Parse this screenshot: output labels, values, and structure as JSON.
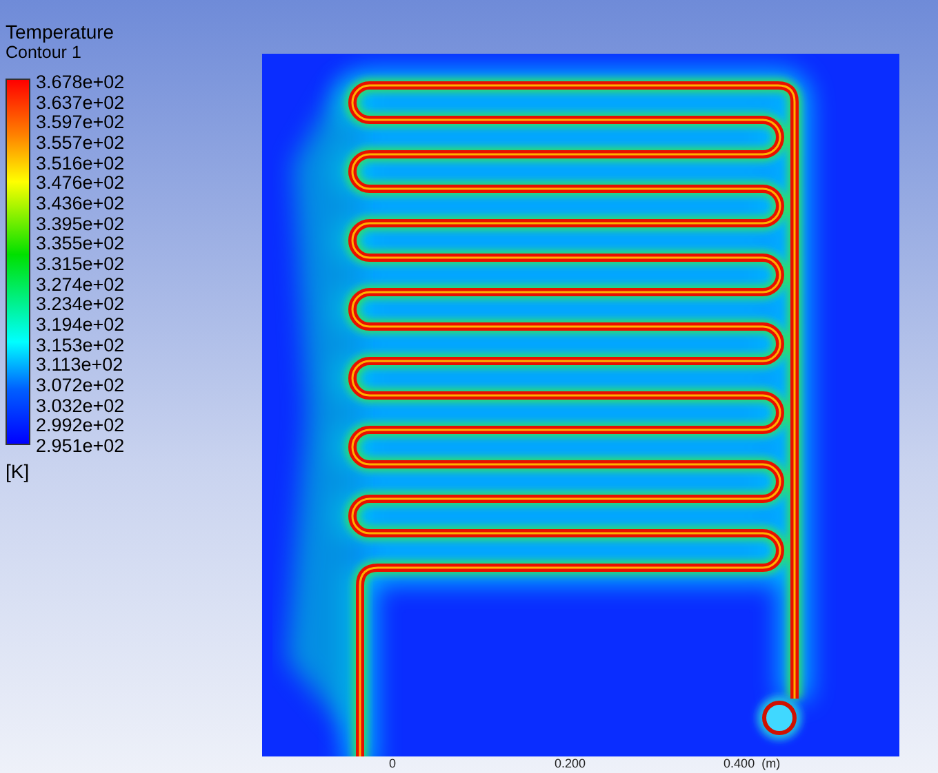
{
  "legend": {
    "title": "Temperature",
    "subtitle": "Contour 1",
    "labels": [
      "3.678e+02",
      "3.637e+02",
      "3.597e+02",
      "3.557e+02",
      "3.516e+02",
      "3.476e+02",
      "3.436e+02",
      "3.395e+02",
      "3.355e+02",
      "3.315e+02",
      "3.274e+02",
      "3.234e+02",
      "3.194e+02",
      "3.153e+02",
      "3.113e+02",
      "3.072e+02",
      "3.032e+02",
      "2.992e+02",
      "2.951e+02"
    ],
    "unit": "[K]"
  },
  "plot": {
    "axis_labels": [
      "0",
      "0.200",
      "0.400",
      "(m)"
    ]
  }
}
